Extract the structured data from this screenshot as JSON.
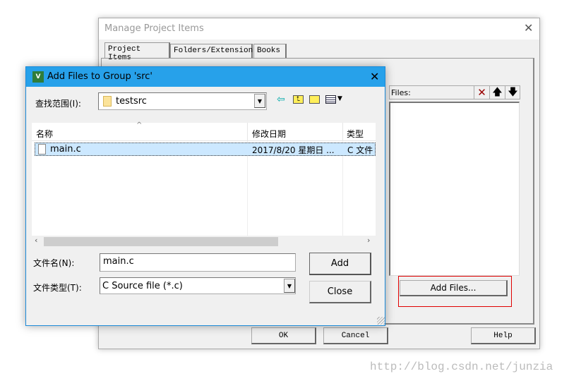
{
  "back_window": {
    "title": "Manage Project Items",
    "tabs": [
      {
        "label": "Project Items",
        "selected": true
      },
      {
        "label": "Folders/Extensions"
      },
      {
        "label": "Books"
      }
    ],
    "files_label": "Files:",
    "add_files_label": "Add Files...",
    "ok_label": "OK",
    "cancel_label": "Cancel",
    "help_label": "Help"
  },
  "dialog": {
    "title": "Add Files to Group 'src'",
    "look_in_label": "查找范围(I):",
    "look_in_value": "testsrc",
    "columns": [
      "名称",
      "修改日期",
      "类型"
    ],
    "rows": [
      {
        "name": "main.c",
        "modified": "2017/8/20 星期日 ...",
        "type": "C 文件",
        "selected": true
      }
    ],
    "filename_label": "文件名(N):",
    "filename_value": "main.c",
    "filetype_label": "文件类型(T):",
    "filetype_value": "C Source file (*.c)",
    "add_label": "Add",
    "close_label": "Close"
  },
  "watermark": "http://blog.csdn.net/junzia",
  "colors": {
    "titlebar": "#27a1ea",
    "selection": "#cce8ff",
    "highlight_box": "#e00000"
  }
}
